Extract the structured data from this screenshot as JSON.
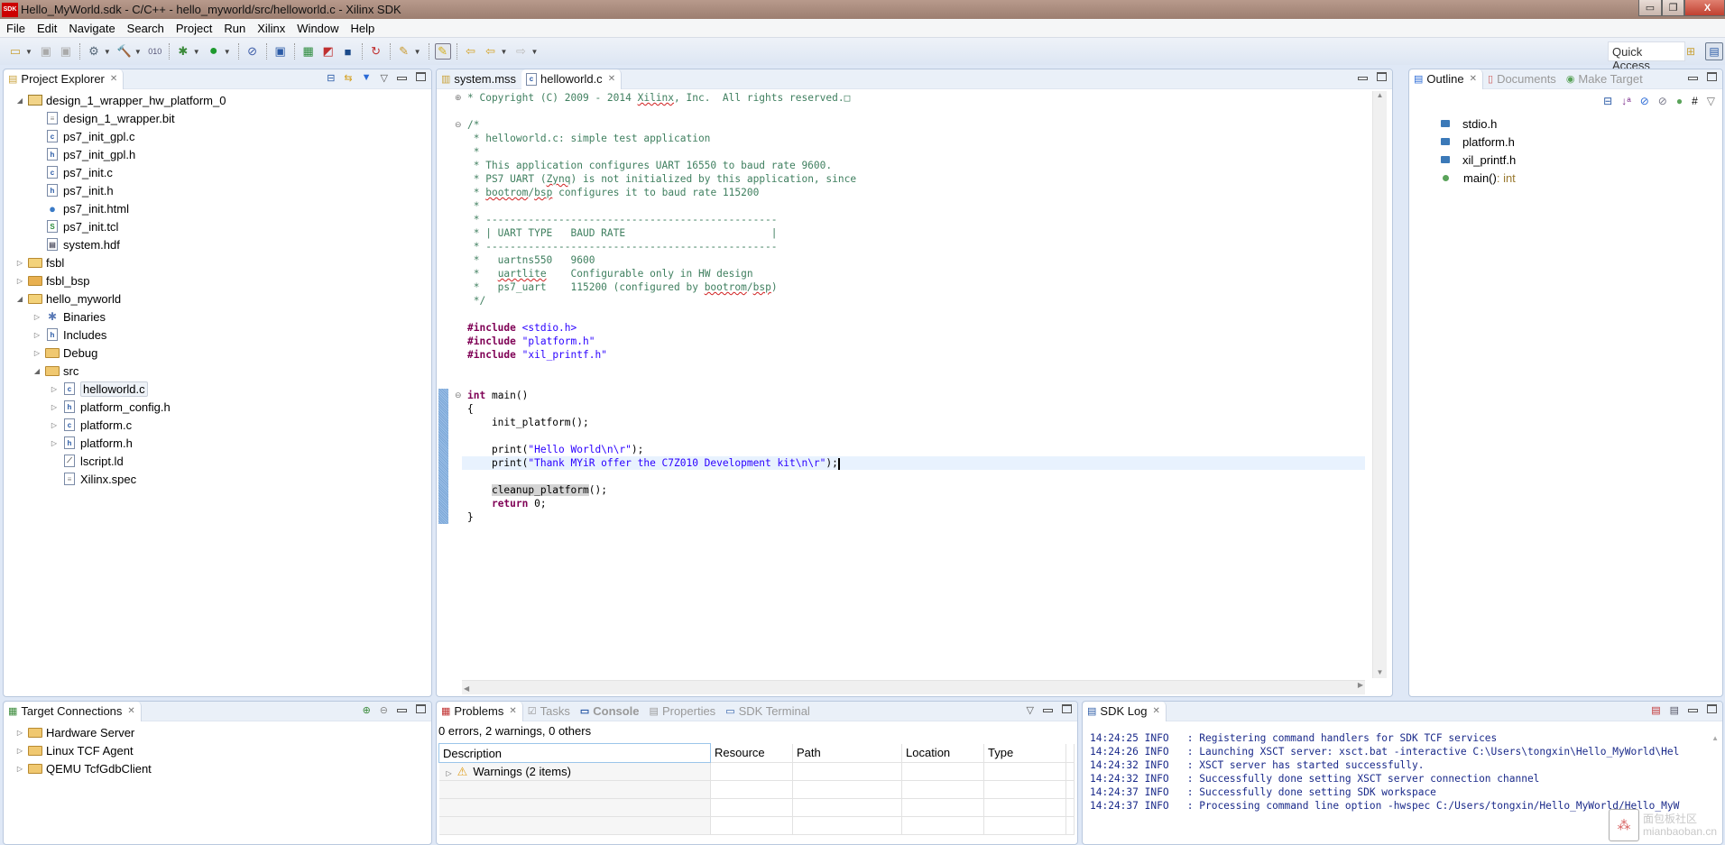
{
  "window": {
    "title": "Hello_MyWorld.sdk - C/C++ - hello_myworld/src/helloworld.c - Xilinx SDK",
    "logo_text": "SDK",
    "controls": {
      "minimize": "▭",
      "restore": "❐",
      "close": "X"
    }
  },
  "menu": [
    "File",
    "Edit",
    "Navigate",
    "Search",
    "Project",
    "Run",
    "Xilinx",
    "Window",
    "Help"
  ],
  "toolbar": {
    "quick_access": "Quick Access",
    "buttons": [
      "new-icon",
      "save-icon",
      "save-all-icon",
      "build-configurations-icon",
      "build-icon",
      "binary-icon",
      "debug-icon",
      "run-icon",
      "skip-breakpoints-icon",
      "xsct-console-icon",
      "program-fpga-icon",
      "xilinx-tool-icon",
      "terminal-icon",
      "repository-icon",
      "annotation-icon",
      "highlight-icon",
      "last-edit-icon",
      "back-icon",
      "forward-icon"
    ]
  },
  "project_explorer": {
    "title": "Project Explorer",
    "items": [
      {
        "label": "design_1_wrapper_hw_platform_0",
        "level": 0,
        "expander": "open",
        "icon": "hw-project-icon"
      },
      {
        "label": "design_1_wrapper.bit",
        "level": 1,
        "icon": "file-icon"
      },
      {
        "label": "ps7_init_gpl.c",
        "level": 1,
        "icon": "c-file-icon"
      },
      {
        "label": "ps7_init_gpl.h",
        "level": 1,
        "icon": "h-file-icon"
      },
      {
        "label": "ps7_init.c",
        "level": 1,
        "icon": "c-file-icon"
      },
      {
        "label": "ps7_init.h",
        "level": 1,
        "icon": "h-file-icon"
      },
      {
        "label": "ps7_init.html",
        "level": 1,
        "icon": "html-file-icon"
      },
      {
        "label": "ps7_init.tcl",
        "level": 1,
        "icon": "tcl-file-icon"
      },
      {
        "label": "system.hdf",
        "level": 1,
        "icon": "hdf-file-icon"
      },
      {
        "label": "fsbl",
        "level": 0,
        "expander": "closed",
        "icon": "c-project-icon"
      },
      {
        "label": "fsbl_bsp",
        "level": 0,
        "expander": "closed",
        "icon": "bsp-project-icon"
      },
      {
        "label": "hello_myworld",
        "level": 0,
        "expander": "open",
        "icon": "c-project-icon"
      },
      {
        "label": "Binaries",
        "level": 1,
        "expander": "closed",
        "icon": "binaries-icon"
      },
      {
        "label": "Includes",
        "level": 1,
        "expander": "closed",
        "icon": "includes-icon"
      },
      {
        "label": "Debug",
        "level": 1,
        "expander": "closed",
        "icon": "folder-icon"
      },
      {
        "label": "src",
        "level": 1,
        "expander": "open",
        "icon": "folder-icon"
      },
      {
        "label": "helloworld.c",
        "level": 2,
        "expander": "closed",
        "icon": "c-file-icon",
        "selected": true
      },
      {
        "label": "platform_config.h",
        "level": 2,
        "expander": "closed",
        "icon": "h-file-icon"
      },
      {
        "label": "platform.c",
        "level": 2,
        "expander": "closed",
        "icon": "c-file-icon"
      },
      {
        "label": "platform.h",
        "level": 2,
        "expander": "closed",
        "icon": "h-file-icon"
      },
      {
        "label": "lscript.ld",
        "level": 2,
        "icon": "linker-script-icon"
      },
      {
        "label": "Xilinx.spec",
        "level": 2,
        "icon": "file-icon"
      }
    ]
  },
  "editor": {
    "tabs": [
      {
        "label": "system.mss",
        "active": false
      },
      {
        "label": "helloworld.c",
        "active": true
      }
    ],
    "lines": [
      {
        "fold": "plus",
        "segs": [
          [
            "cm",
            "* Copyright (C) 2009 - 2014 "
          ],
          [
            "cmsq",
            "Xilinx"
          ],
          [
            "cm",
            ", Inc.  All rights reserved.□"
          ]
        ]
      },
      {
        "segs": []
      },
      {
        "fold": "minus",
        "segs": [
          [
            "cm",
            "/*"
          ]
        ]
      },
      {
        "segs": [
          [
            "cm",
            " * helloworld.c: simple test application"
          ]
        ]
      },
      {
        "segs": [
          [
            "cm",
            " *"
          ]
        ]
      },
      {
        "segs": [
          [
            "cm",
            " * This application configures UART 16550 to baud rate 9600."
          ]
        ]
      },
      {
        "segs": [
          [
            "cm",
            " * PS7 UART ("
          ],
          [
            "cmsq",
            "Zynq"
          ],
          [
            "cm",
            ") is not initialized by this application, since"
          ]
        ]
      },
      {
        "segs": [
          [
            "cm",
            " * "
          ],
          [
            "cmsq",
            "bootrom"
          ],
          [
            "cm",
            "/"
          ],
          [
            "cmsq",
            "bsp"
          ],
          [
            "cm",
            " configures it to baud rate 115200"
          ]
        ]
      },
      {
        "segs": [
          [
            "cm",
            " *"
          ]
        ]
      },
      {
        "segs": [
          [
            "cm",
            " * ------------------------------------------------"
          ]
        ]
      },
      {
        "segs": [
          [
            "cm",
            " * | UART TYPE   BAUD RATE                        |"
          ]
        ]
      },
      {
        "segs": [
          [
            "cm",
            " * ------------------------------------------------"
          ]
        ]
      },
      {
        "segs": [
          [
            "cm",
            " *   uartns550   9600"
          ]
        ]
      },
      {
        "segs": [
          [
            "cm",
            " *   "
          ],
          [
            "cmsq",
            "uartlite"
          ],
          [
            "cm",
            "    Configurable only in HW design"
          ]
        ]
      },
      {
        "segs": [
          [
            "cm",
            " *   ps7_uart    115200 (configured by "
          ],
          [
            "cmsq",
            "bootrom"
          ],
          [
            "cm",
            "/"
          ],
          [
            "cmsq",
            "bsp"
          ],
          [
            "cm",
            ")"
          ]
        ]
      },
      {
        "segs": [
          [
            "cm",
            " */"
          ]
        ]
      },
      {
        "segs": []
      },
      {
        "segs": [
          [
            "kw",
            "#include"
          ],
          [
            "tx",
            " "
          ],
          [
            "inc",
            "<stdio.h>"
          ]
        ]
      },
      {
        "segs": [
          [
            "kw",
            "#include"
          ],
          [
            "tx",
            " "
          ],
          [
            "st",
            "\"platform.h\""
          ]
        ]
      },
      {
        "segs": [
          [
            "kw",
            "#include"
          ],
          [
            "tx",
            " "
          ],
          [
            "st",
            "\"xil_printf.h\""
          ]
        ]
      },
      {
        "segs": []
      },
      {
        "segs": []
      },
      {
        "fold": "minus",
        "segs": [
          [
            "kw",
            "int"
          ],
          [
            "tx",
            " main()"
          ]
        ]
      },
      {
        "segs": [
          [
            "tx",
            "{"
          ]
        ]
      },
      {
        "segs": [
          [
            "tx",
            "    init_platform();"
          ]
        ]
      },
      {
        "segs": []
      },
      {
        "segs": [
          [
            "tx",
            "    print("
          ],
          [
            "st",
            "\"Hello World\\n\\r\""
          ],
          [
            "tx",
            ");"
          ]
        ]
      },
      {
        "current": true,
        "segs": [
          [
            "tx",
            "    print("
          ],
          [
            "st",
            "\"Thank MYiR offer the C7Z010 Development kit\\n\\r\""
          ],
          [
            "tx",
            ");"
          ]
        ]
      },
      {
        "segs": []
      },
      {
        "segs": [
          [
            "tx",
            "    "
          ],
          [
            "hl",
            "cleanup_platform"
          ],
          [
            "tx",
            "();"
          ]
        ]
      },
      {
        "segs": [
          [
            "tx",
            "    "
          ],
          [
            "kw",
            "return"
          ],
          [
            "tx",
            " 0;"
          ]
        ]
      },
      {
        "segs": [
          [
            "tx",
            "}"
          ]
        ]
      }
    ]
  },
  "outline": {
    "tabs": [
      {
        "label": "Outline",
        "active": true
      },
      {
        "label": "Documents",
        "active": false
      },
      {
        "label": "Make Target",
        "active": false
      }
    ],
    "items": [
      {
        "label": "stdio.h",
        "type": "include"
      },
      {
        "label": "platform.h",
        "type": "include"
      },
      {
        "label": "xil_printf.h",
        "type": "include"
      },
      {
        "label": "main()",
        "suffix": " : int",
        "type": "function"
      }
    ]
  },
  "target_connections": {
    "title": "Target Connections",
    "items": [
      "Hardware Server",
      "Linux TCF Agent",
      "QEMU TcfGdbClient"
    ]
  },
  "problems": {
    "tabs": [
      {
        "label": "Problems",
        "active": true
      },
      {
        "label": "Tasks",
        "active": false
      },
      {
        "label": "Console",
        "active": false,
        "bold": true
      },
      {
        "label": "Properties",
        "active": false
      },
      {
        "label": "SDK Terminal",
        "active": false
      }
    ],
    "summary": "0 errors, 2 warnings, 0 others",
    "columns": [
      "Description",
      "Resource",
      "Path",
      "Location",
      "Type"
    ],
    "rows": [
      {
        "description": "Warnings (2 items)",
        "resource": "",
        "path": "",
        "location": "",
        "type": ""
      }
    ]
  },
  "sdk_log": {
    "title": "SDK Log",
    "lines": [
      "14:24:25 INFO   : Registering command handlers for SDK TCF services",
      "14:24:26 INFO   : Launching XSCT server: xsct.bat -interactive C:\\Users\\tongxin\\Hello_MyWorld\\Hel",
      "14:24:32 INFO   : XSCT server has started successfully.",
      "14:24:32 INFO   : Successfully done setting XSCT server connection channel",
      "14:24:37 INFO   : Successfully done setting SDK workspace",
      "14:24:37 INFO   : Processing command line option -hwspec C:/Users/tongxin/Hello_MyWorld/Hello_MyW"
    ]
  },
  "watermark": {
    "line1": "面包板社区",
    "line2": "mianbaoban.cn"
  }
}
